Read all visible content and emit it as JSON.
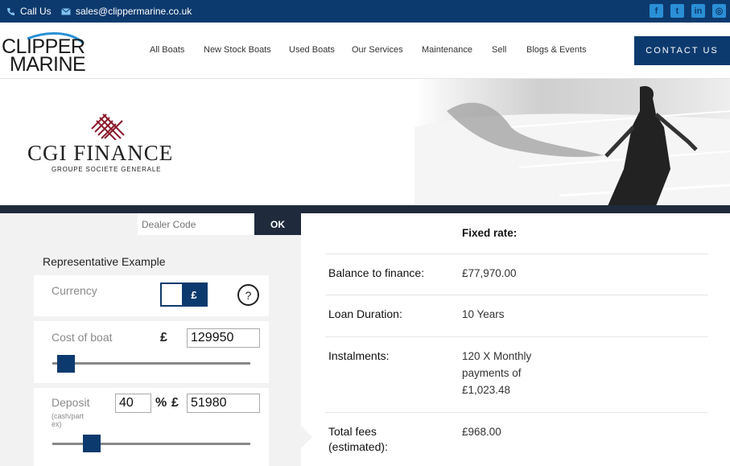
{
  "topbar": {
    "phone_label": "Call Us",
    "email": "sales@clippermarine.co.uk",
    "social": [
      "facebook-icon",
      "twitter-icon",
      "linkedin-icon",
      "instagram-icon"
    ]
  },
  "logo": {
    "line1": "CLIPPER",
    "line2": "MARINE"
  },
  "nav": [
    "All Boats",
    "New Stock Boats",
    "Used Boats",
    "Our Services",
    "Maintenance",
    "Sell",
    "Blogs & Events"
  ],
  "contact_button": "CONTACT US",
  "banner": {
    "brand": "CGI FINANCE",
    "tagline": "GROUPE SOCIETE GENERALE"
  },
  "dealer": {
    "placeholder": "Dealer Code",
    "ok_label": "OK"
  },
  "calculator": {
    "title": "Representative Example",
    "currency_label": "Currency",
    "currency_symbol": "£",
    "help_label": "?",
    "cost_label": "Cost of boat",
    "cost_currency": "£",
    "cost_value": "129950",
    "deposit_label": "Deposit",
    "deposit_sublabel": "(cash/part ex)",
    "deposit_percent": "40",
    "percent_symbol": "%",
    "deposit_currency": "£",
    "deposit_value": "51980",
    "cost_slider_fraction": 0.07,
    "deposit_slider_fraction": 0.2
  },
  "results": {
    "rate_label": "Fixed rate:",
    "balance_label": "Balance to finance:",
    "balance_value": "£77,970.00",
    "duration_label": "Loan Duration:",
    "duration_value": "10 Years",
    "instalments_label": "Instalments:",
    "instalments_value": "120 X Monthly payments of £1,023.48",
    "fees_label": "Total fees (estimated):",
    "fees_value": "£968.00"
  },
  "colors": {
    "navy": "#0d3a6e",
    "dark": "#1f2b3c",
    "panel": "#f2f2f2",
    "brand_red": "#8b1a2b"
  }
}
